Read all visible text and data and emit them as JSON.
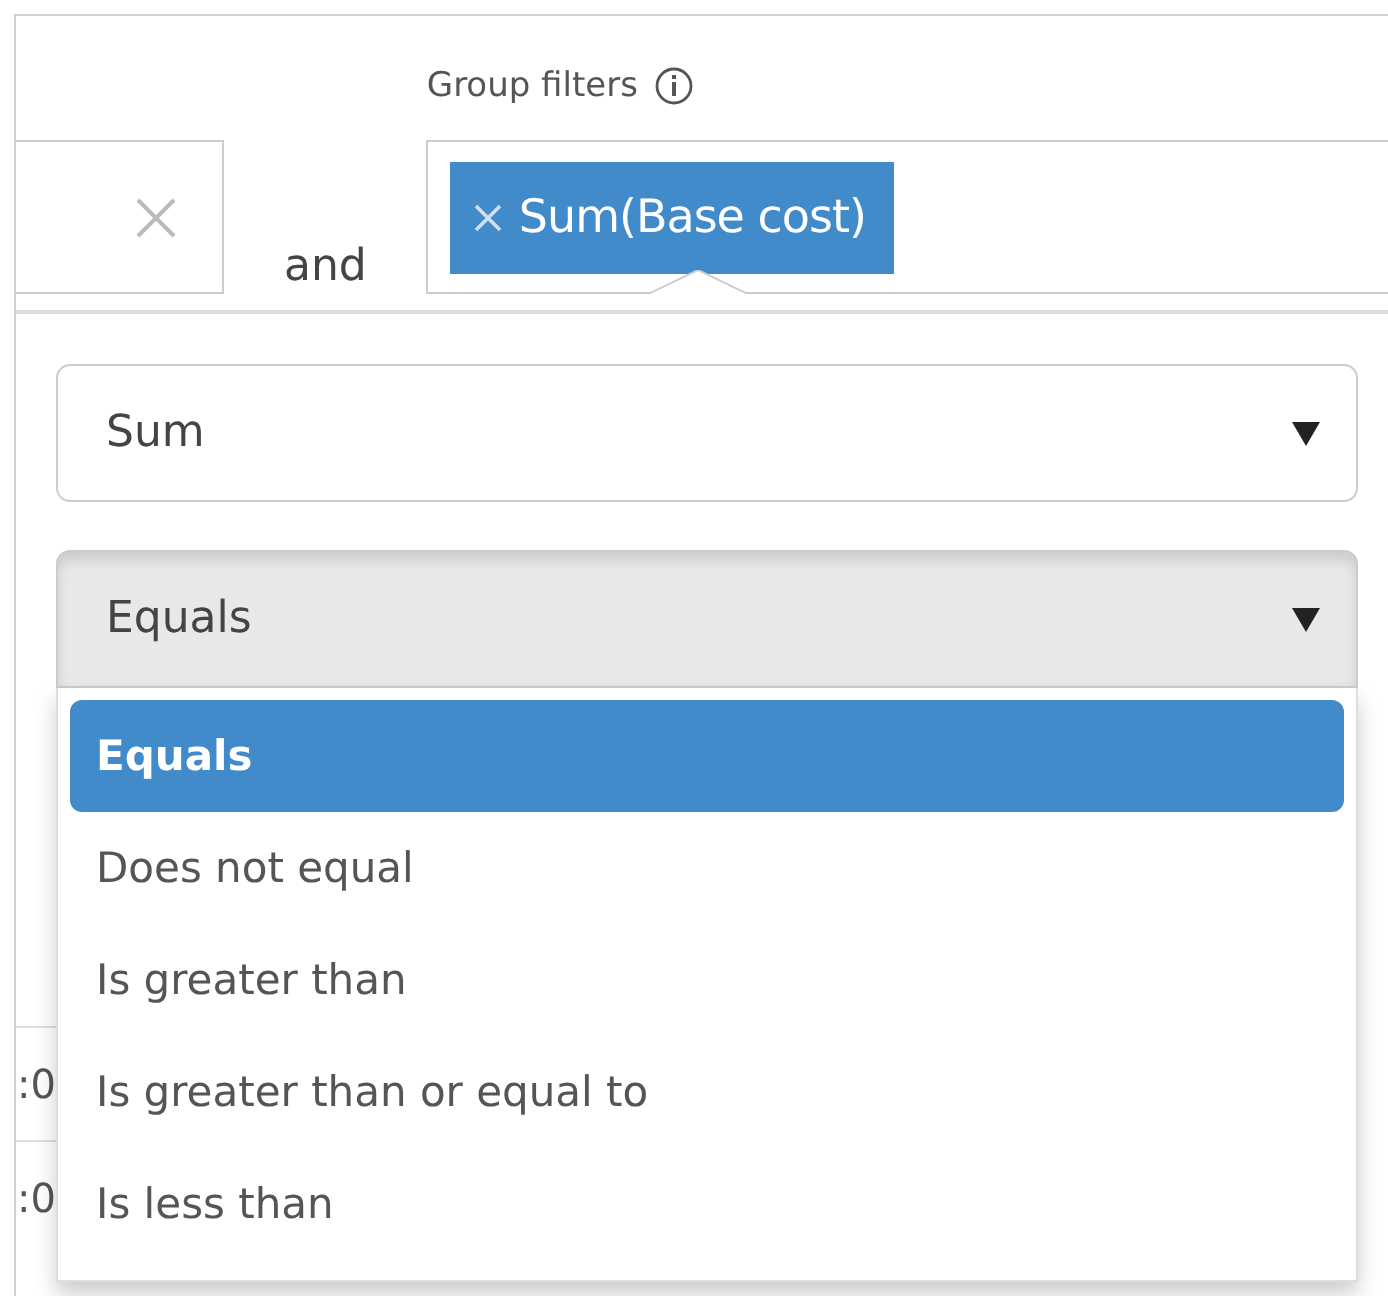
{
  "left_filter": {
    "clearable": true
  },
  "connector": "and",
  "group_filters": {
    "label": "Group filters",
    "chips": [
      {
        "label": "Sum(Base cost)"
      }
    ]
  },
  "aggregate_select": {
    "value": "Sum",
    "open": false
  },
  "operator_select": {
    "value": "Equals",
    "open": true,
    "options": [
      {
        "label": "Equals",
        "selected": true
      },
      {
        "label": "Does not equal",
        "selected": false
      },
      {
        "label": "Is greater than",
        "selected": false
      },
      {
        "label": "Is greater than or equal to",
        "selected": false
      },
      {
        "label": "Is less than",
        "selected": false
      }
    ]
  },
  "background_cells": [
    ":0",
    ":0"
  ]
}
